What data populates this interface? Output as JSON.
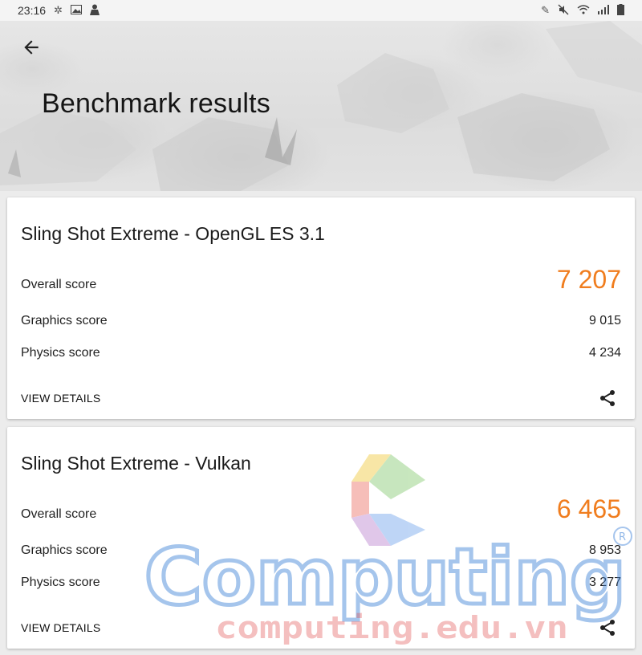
{
  "status_bar": {
    "time": "23:16",
    "left_icons": [
      "settings-icon",
      "image-icon",
      "person-icon"
    ],
    "right_icons": [
      "pen-icon",
      "mute-icon",
      "wifi-icon",
      "signal-icon",
      "battery-icon"
    ]
  },
  "header": {
    "title": "Benchmark results",
    "back_icon": "arrow-left-icon"
  },
  "results": [
    {
      "title": "Sling Shot Extreme - OpenGL ES 3.1",
      "overall_label": "Overall score",
      "overall_value": "7 207",
      "graphics_label": "Graphics score",
      "graphics_value": "9 015",
      "physics_label": "Physics score",
      "physics_value": "4 234",
      "details_label": "VIEW DETAILS"
    },
    {
      "title": "Sling Shot Extreme - Vulkan",
      "overall_label": "Overall score",
      "overall_value": "6 465",
      "graphics_label": "Graphics score",
      "graphics_value": "8 953",
      "physics_label": "Physics score",
      "physics_value": "3 277",
      "details_label": "VIEW DETAILS"
    }
  ],
  "watermark": {
    "brand": "Computing",
    "domain": "computing.edu.vn",
    "registered_mark": "R"
  },
  "colors": {
    "accent": "#f07d1e",
    "watermark_blue": "#3a7fd6",
    "watermark_red": "#e14b4b"
  }
}
